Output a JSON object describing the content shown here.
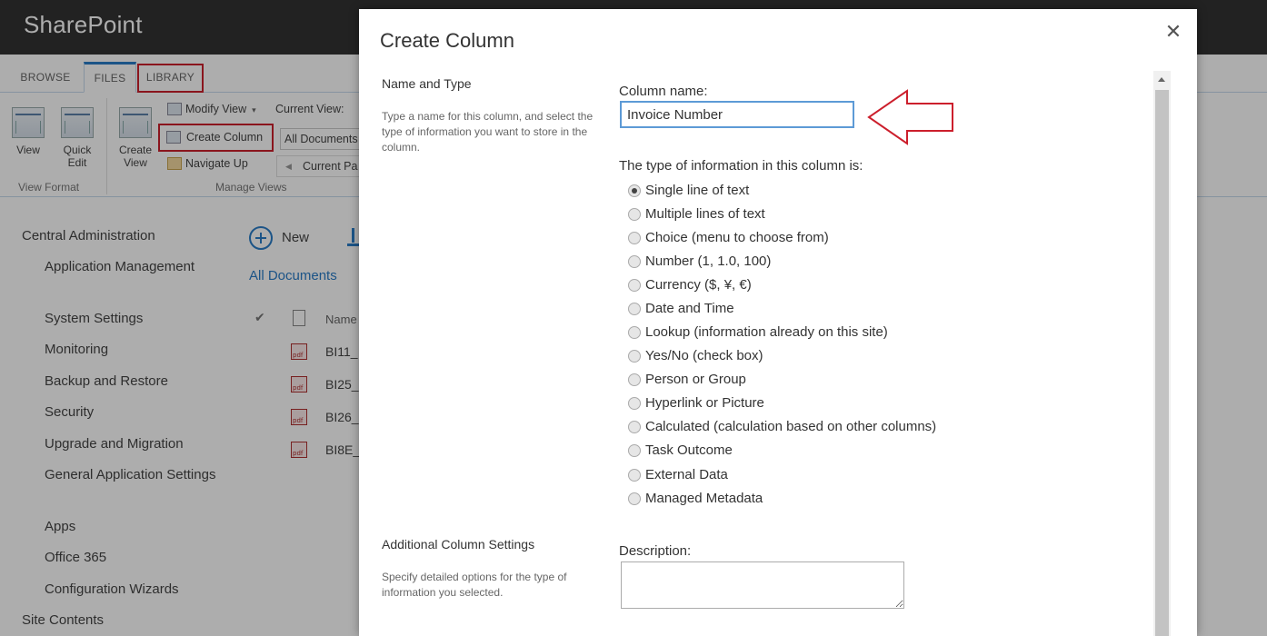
{
  "suitebar": {
    "brand": "SharePoint"
  },
  "ribbon_tabs": [
    {
      "label": "BROWSE"
    },
    {
      "label": "FILES"
    },
    {
      "label": "LIBRARY"
    }
  ],
  "ribbon": {
    "view": "View",
    "quick_edit": "Quick Edit",
    "create_view": "Create View",
    "modify_view": "Modify View",
    "create_column": "Create Column",
    "navigate_up": "Navigate Up",
    "current_view_label": "Current View:",
    "current_view_value": "All Documents",
    "current_page": "Current Pa",
    "group_view_format": "View Format",
    "group_manage_views": "Manage Views"
  },
  "leftnav": {
    "central_admin": "Central Administration",
    "items": [
      "Application Management",
      "System Settings",
      "Monitoring",
      "Backup and Restore",
      "Security",
      "Upgrade and Migration",
      "General Application Settings",
      "Apps",
      "Office 365",
      "Configuration Wizards"
    ],
    "site_contents": "Site Contents"
  },
  "docs": {
    "new_label": "New",
    "all_documents": "All Documents",
    "name_col": "Name",
    "rows": [
      "BI11_",
      "BI25_",
      "BI26_",
      "BI8E_"
    ]
  },
  "dialog": {
    "title": "Create Column",
    "close": "✕",
    "name_type_title": "Name and Type",
    "name_type_desc": "Type a name for this column, and select the type of information you want to store in the column.",
    "column_name_label": "Column name:",
    "column_name_value": "Invoice Number",
    "type_label": "The type of information in this column is:",
    "types": [
      "Single line of text",
      "Multiple lines of text",
      "Choice (menu to choose from)",
      "Number (1, 1.0, 100)",
      "Currency ($, ¥, €)",
      "Date and Time",
      "Lookup (information already on this site)",
      "Yes/No (check box)",
      "Person or Group",
      "Hyperlink or Picture",
      "Calculated (calculation based on other columns)",
      "Task Outcome",
      "External Data",
      "Managed Metadata"
    ],
    "selected_type": 0,
    "additional_title": "Additional Column Settings",
    "additional_desc": "Specify detailed options for the type of information you selected.",
    "description_label": "Description:",
    "description_value": ""
  },
  "colors": {
    "suitebar": "#333333",
    "accent": "#2a7cc7",
    "highlight": "#cc1f2c",
    "input_border": "#5d9ad6"
  }
}
